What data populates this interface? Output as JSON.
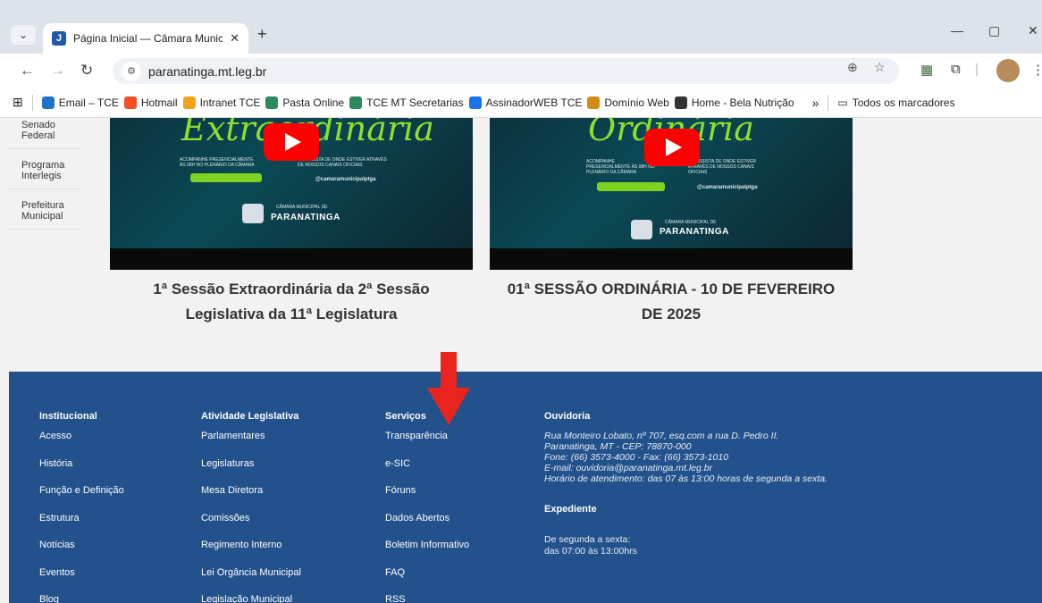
{
  "browser": {
    "tab_title": "Página Inicial — Câmara Munici",
    "tab_close": "✕",
    "new_tab": "+",
    "url": "paranatinga.mt.leg.br",
    "bookmarks": [
      {
        "label": "Email – TCE",
        "color": "#1e73c8"
      },
      {
        "label": "Hotmail",
        "color": "#f25022"
      },
      {
        "label": "Intranet TCE",
        "color": "#f3a31b"
      },
      {
        "label": "Pasta Online",
        "color": "#2c8a5b"
      },
      {
        "label": "TCE MT Secretarias",
        "color": "#2c8a5b"
      },
      {
        "label": "AssinadorWEB TCE",
        "color": "#1a73e8"
      },
      {
        "label": "Domínio Web",
        "color": "#d38b1a"
      },
      {
        "label": "Home - Bela Nutrição",
        "color": "#333333"
      }
    ],
    "more_bookmarks": "»",
    "all_bookmarks": "Todos os marcadores"
  },
  "sidebar": {
    "items": [
      "Senado Federal",
      "Programa Interlegis",
      "Prefeitura Municipal"
    ]
  },
  "videos": [
    {
      "script_title": "Extraordinária",
      "caption_line1": "1ª Sessão Extraordinária da 2ª Sessão",
      "caption_line2": "Legislativa da 11ª Legislatura",
      "brand": "PARANATINGA",
      "brand_small": "CÂMARA MUNICIPAL DE",
      "handle": "@camaramunicipalptga"
    },
    {
      "script_title": "Ordinária",
      "caption_line1": "01ª SESSÃO ORDINÁRIA - 10 DE FEVEREIRO",
      "caption_line2": "DE 2025",
      "brand": "PARANATINGA",
      "brand_small": "CÂMARA MUNICIPAL DE",
      "handle": "@camaramunicipalptga"
    }
  ],
  "footer": {
    "institucional": {
      "heading": "Institucional",
      "links": [
        "Acesso",
        "História",
        "Função e Definição",
        "Estrutura",
        "Notícias",
        "Eventos",
        "Blog"
      ]
    },
    "atividade": {
      "heading": "Atividade Legislativa",
      "links": [
        "Parlamentares",
        "Legislaturas",
        "Mesa Diretora",
        "Comissões",
        "Regimento Interno",
        "Lei Orgância Municipal",
        "Legislação Municipal"
      ]
    },
    "servicos": {
      "heading": "Serviços",
      "links": [
        "Transparência",
        "e-SIC",
        "Fóruns",
        "Dados Abertos",
        "Boletim Informativo",
        "FAQ",
        "RSS"
      ]
    },
    "ouvidoria": {
      "heading": "Ouvidoria",
      "address1": "Rua Monteiro Lobato, nº 707, esq.com a rua D. Pedro II.",
      "address2": "Paranatinga, MT - CEP: 78870-000",
      "phone": "Fone: (66) 3573-4000 - Fax: (66) 3573-1010",
      "email": "E-mail: ouvidoria@paranatinga.mt.leg.br",
      "hours": "Horário de atendimento: das 07 às 13:00 horas de segunda a sexta."
    },
    "expediente": {
      "heading": "Expediente",
      "line1": "De segunda a sexta:",
      "line2": "das 07:00 às 13:00hrs"
    }
  },
  "colors": {
    "footer_bg": "#23518b",
    "arrow": "#e8241c",
    "youtube": "#ff0000"
  }
}
